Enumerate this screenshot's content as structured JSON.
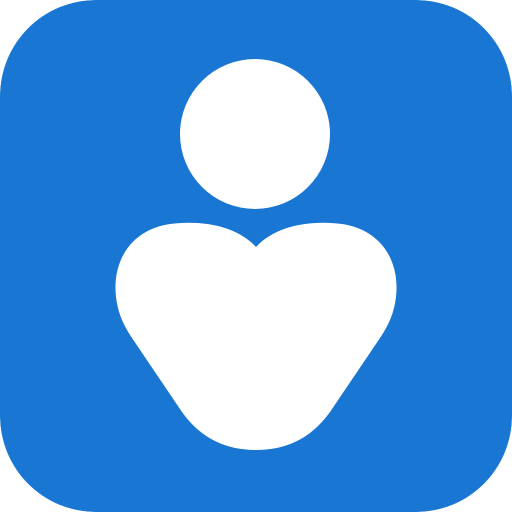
{
  "icon": {
    "name": "person-heart-icon",
    "colors": {
      "background": "#1976D2",
      "glyph": "#FFFFFF"
    }
  }
}
